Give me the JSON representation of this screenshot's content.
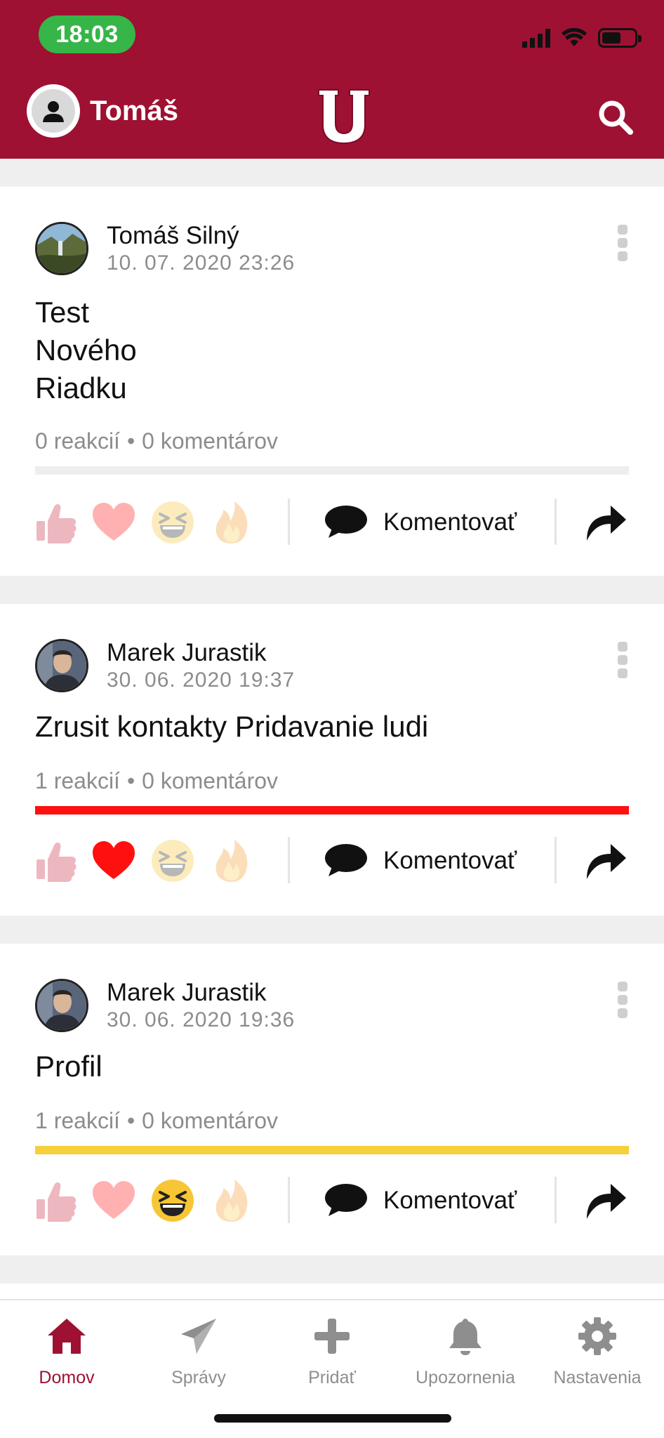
{
  "status_bar": {
    "time": "18:03"
  },
  "header": {
    "user_name": "Tomáš",
    "logo_letter": "U"
  },
  "posts": [
    {
      "author": "Tomáš Silný",
      "date": "10. 07. 2020 23:26",
      "text": "Test\nNového\nRiadku",
      "reactions_text": "0 reakcií",
      "comments_text": "0 komentárov",
      "dot": "•",
      "comment_label": "Komentovať",
      "bar_color": "#eeeeee",
      "active_reaction": "none"
    },
    {
      "author": "Marek Jurastik",
      "date": "30. 06. 2020 19:37",
      "text": "Zrusit kontakty Pridavanie ludi",
      "reactions_text": "1 reakcií",
      "comments_text": "0 komentárov",
      "dot": "•",
      "comment_label": "Komentovať",
      "bar_color": "#ff1010",
      "active_reaction": "heart"
    },
    {
      "author": "Marek Jurastik",
      "date": "30. 06. 2020 19:36",
      "text": "Profil",
      "reactions_text": "1 reakcií",
      "comments_text": "0 komentárov",
      "dot": "•",
      "comment_label": "Komentovať",
      "bar_color": "#f6d03c",
      "active_reaction": "laugh"
    }
  ],
  "bottom_nav": [
    {
      "label": "Domov",
      "icon": "home-icon",
      "active": true
    },
    {
      "label": "Správy",
      "icon": "paper-plane-icon",
      "active": false
    },
    {
      "label": "Pridať",
      "icon": "plus-icon",
      "active": false
    },
    {
      "label": "Upozornenia",
      "icon": "bell-icon",
      "active": false
    },
    {
      "label": "Nastavenia",
      "icon": "gear-icon",
      "active": false
    }
  ],
  "colors": {
    "brand": "#9e1132",
    "status_green": "#36b548"
  }
}
